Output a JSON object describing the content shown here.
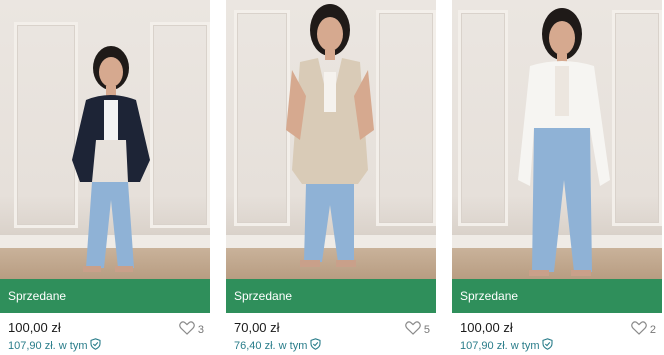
{
  "cards": [
    {
      "status": "Sprzedane",
      "price": "100,00 zł",
      "fee_price": "107,90 zł. w tym",
      "favourites": "3",
      "icons": {
        "favourite": "heart-icon",
        "protection": "shield-check-icon"
      }
    },
    {
      "status": "Sprzedane",
      "price": "70,00 zł",
      "fee_price": "76,40 zł. w tym",
      "favourites": "5",
      "icons": {
        "favourite": "heart-icon",
        "protection": "shield-check-icon"
      }
    },
    {
      "status": "Sprzedane",
      "price": "100,00 zł",
      "fee_price": "107,90 zł. w tym",
      "favourites": "2",
      "icons": {
        "favourite": "heart-icon",
        "protection": "shield-check-icon"
      }
    }
  ],
  "colors": {
    "sold_banner": "#2f8f5b",
    "fee_text": "#2a7d8a"
  }
}
